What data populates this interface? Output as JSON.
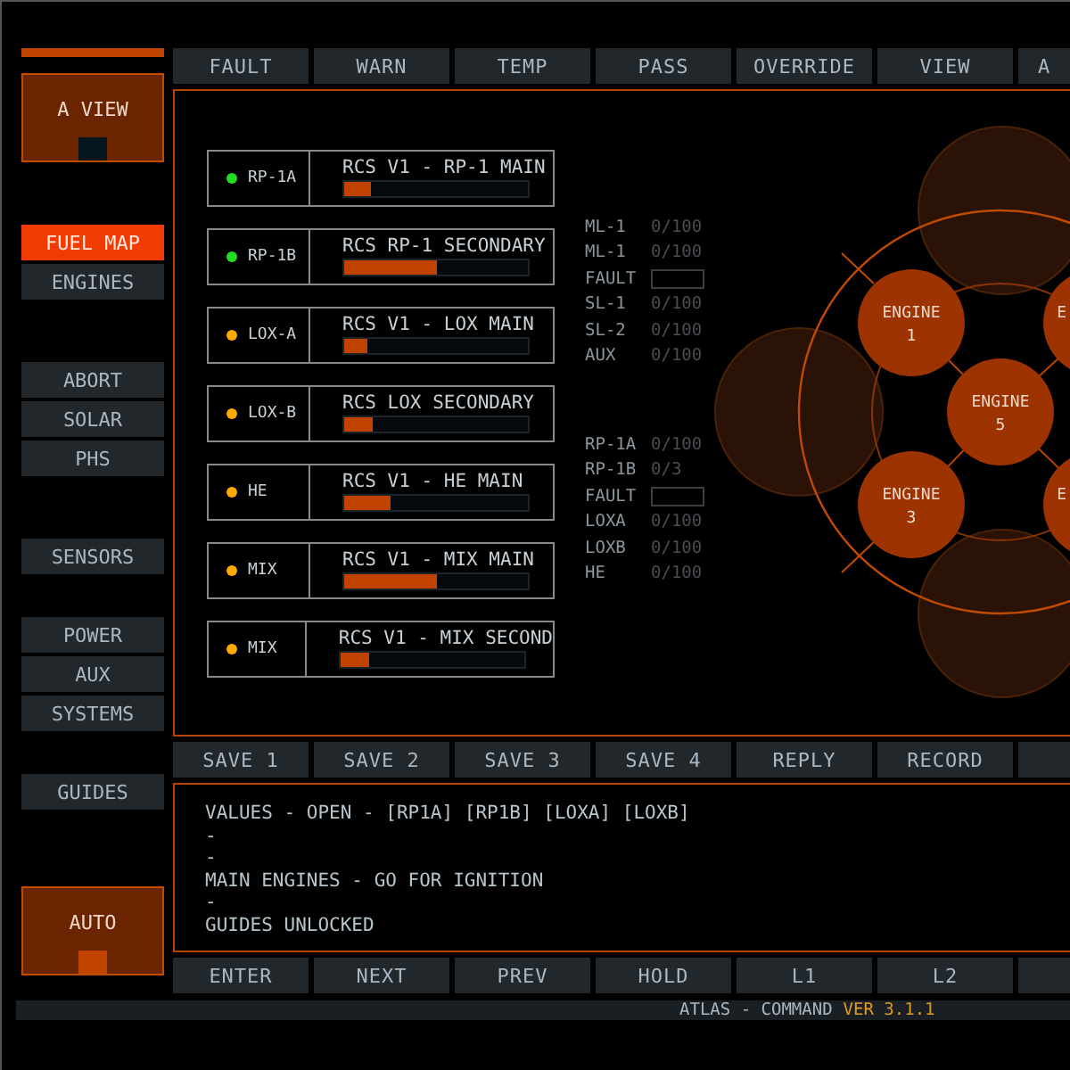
{
  "top_buttons": [
    {
      "label": "FAULT"
    },
    {
      "label": "WARN"
    },
    {
      "label": "TEMP"
    },
    {
      "label": "PASS"
    },
    {
      "label": "OVERRIDE"
    },
    {
      "label": "VIEW"
    },
    {
      "label": "A"
    }
  ],
  "view_tile": {
    "label": "A VIEW"
  },
  "nav_groups": [
    [
      {
        "label": "FUEL MAP",
        "selected": true
      },
      {
        "label": "ENGINES",
        "selected": false
      }
    ],
    [
      {
        "label": "ABORT",
        "selected": false
      },
      {
        "label": "SOLAR",
        "selected": false
      },
      {
        "label": "PHS",
        "selected": false
      }
    ],
    [
      {
        "label": "SENSORS",
        "selected": false
      }
    ],
    [
      {
        "label": "POWER",
        "selected": false
      },
      {
        "label": "AUX",
        "selected": false
      },
      {
        "label": "SYSTEMS",
        "selected": false
      }
    ],
    [
      {
        "label": "GUIDES",
        "selected": false
      }
    ]
  ],
  "auto_tile": {
    "label": "AUTO"
  },
  "valves": [
    {
      "tag": "RP-1A",
      "color": "#22dd22",
      "title": "RCS V1 - RP-1 MAIN",
      "level": 0.15
    },
    {
      "tag": "RP-1B",
      "color": "#22dd22",
      "title": "RCS RP-1 SECONDARY",
      "level": 0.5
    },
    {
      "tag": "LOX-A",
      "color": "#ffaa00",
      "title": "RCS V1 - LOX MAIN",
      "level": 0.13
    },
    {
      "tag": "LOX-B",
      "color": "#ffaa00",
      "title": "RCS LOX SECONDARY",
      "level": 0.16
    },
    {
      "tag": "HE",
      "color": "#ffaa00",
      "title": "RCS V1 - HE MAIN",
      "level": 0.25
    },
    {
      "tag": "MIX",
      "color": "#ffaa00",
      "title": "RCS V1 - MIX MAIN",
      "level": 0.5
    },
    {
      "tag": "MIX",
      "color": "#ffaa00",
      "title": "RCS V1 - MIX SECOND",
      "level": 0.16
    }
  ],
  "readings": [
    [
      {
        "kind": "value",
        "label": "ML-1",
        "value": "0/100"
      },
      {
        "kind": "value",
        "label": "ML-1",
        "value": "0/100"
      },
      {
        "kind": "box",
        "label": "FAULT"
      },
      {
        "kind": "value",
        "label": "SL-1",
        "value": "0/100"
      },
      {
        "kind": "value",
        "label": "SL-2",
        "value": "0/100"
      },
      {
        "kind": "value",
        "label": "AUX",
        "value": "0/100"
      }
    ],
    [
      {
        "kind": "value",
        "label": "RP-1A",
        "value": "0/100"
      },
      {
        "kind": "value",
        "label": "RP-1B",
        "value": "0/3"
      },
      {
        "kind": "box",
        "label": "FAULT"
      },
      {
        "kind": "value",
        "label": "LOXA",
        "value": "0/100"
      },
      {
        "kind": "value",
        "label": "LOXB",
        "value": "0/100"
      },
      {
        "kind": "value",
        "label": "HE",
        "value": "0/100"
      }
    ]
  ],
  "engines": [
    {
      "name": "ENGINE",
      "number": "1"
    },
    {
      "name": "E"
    },
    {
      "name": "ENGINE",
      "number": "5"
    },
    {
      "name": "ENGINE",
      "number": "3"
    },
    {
      "name": "E"
    }
  ],
  "save_buttons": [
    {
      "label": "SAVE 1"
    },
    {
      "label": "SAVE 2"
    },
    {
      "label": "SAVE 3"
    },
    {
      "label": "SAVE 4"
    },
    {
      "label": "REPLY"
    },
    {
      "label": "RECORD"
    }
  ],
  "log": [
    "VALUES - OPEN - [RP1A] [RP1B] [LOXA] [LOXB]",
    "-",
    "-",
    "MAIN ENGINES - GO FOR IGNITION",
    "-",
    "GUIDES UNLOCKED"
  ],
  "bottom_buttons": [
    {
      "label": "ENTER"
    },
    {
      "label": "NEXT"
    },
    {
      "label": "PREV"
    },
    {
      "label": "HOLD"
    },
    {
      "label": "L1"
    },
    {
      "label": "L2"
    }
  ],
  "status_bar": {
    "title": "ATLAS - COMMAND",
    "version": "VER 3.1.1"
  }
}
